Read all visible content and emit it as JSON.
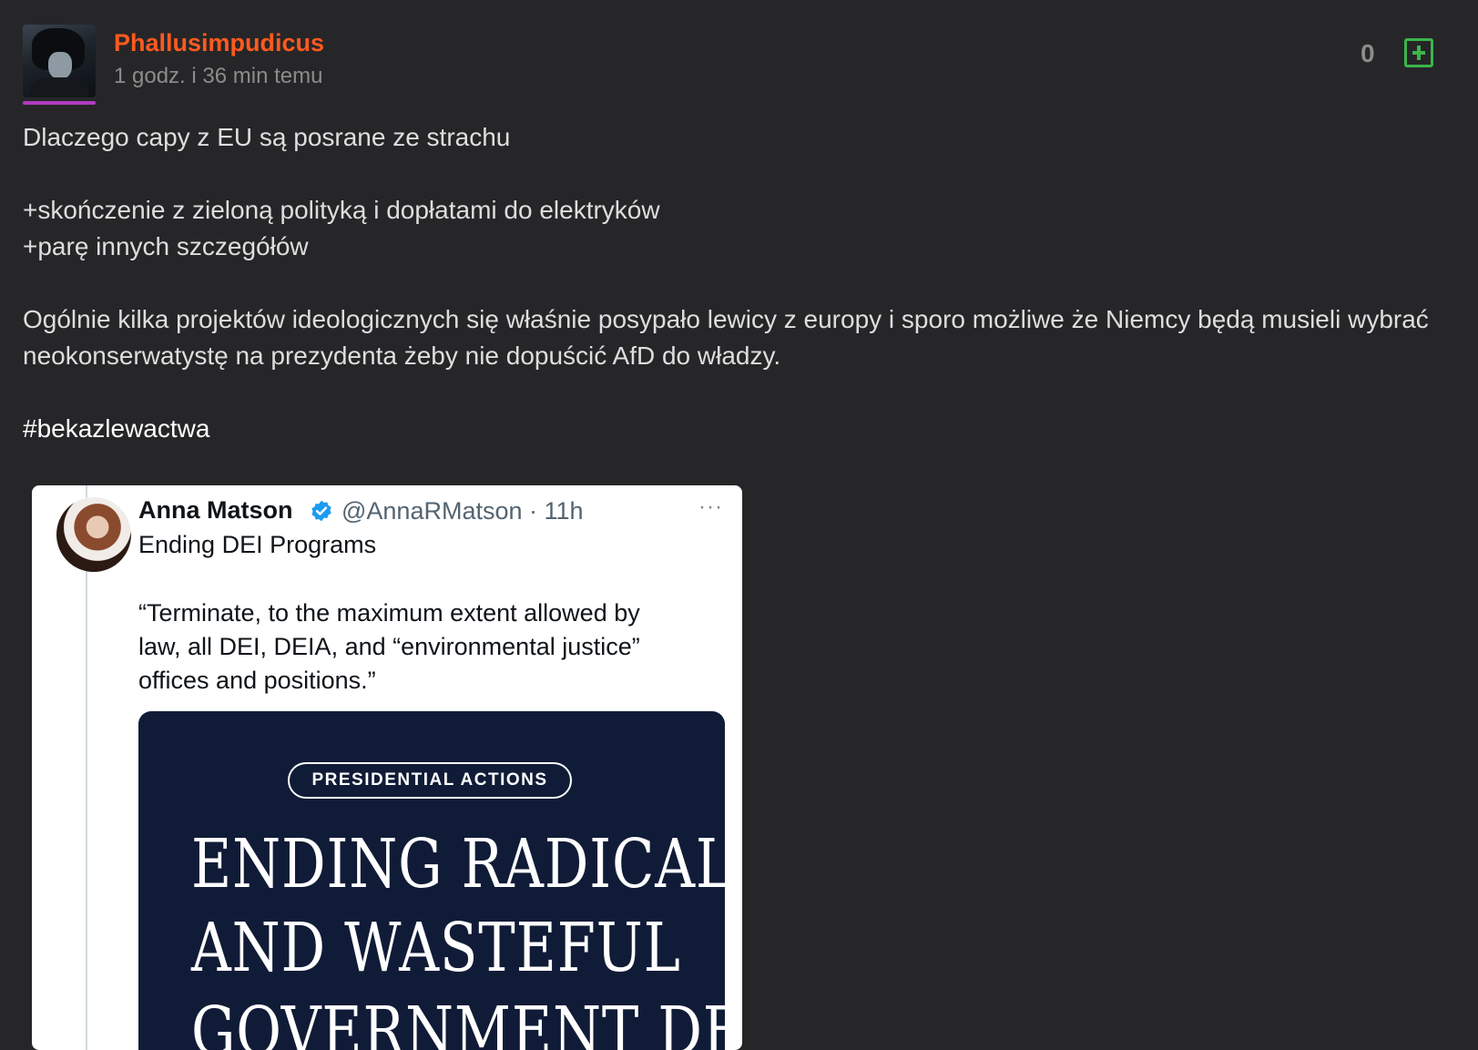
{
  "post": {
    "author": "Phallusimpudicus",
    "timestamp": "1 godz. i 36 min temu",
    "vote_count": "0",
    "colors": {
      "author": "#ff5a1f",
      "vote_button": "#3bb54a",
      "avatar_bar": "#b03cc0"
    },
    "body": {
      "line1": "Dlaczego capy z EU są posrane ze strachu",
      "line2": "+skończenie z zieloną polityką i dopłatami do elektryków",
      "line3": "+parę innych szczegółów",
      "line4": "Ogólnie kilka projektów ideologicznych się właśnie posypało lewicy z europy i sporo możliwe że Niemcy będą musieli wybrać neokonserwatystę na prezydenta żeby nie dopuścić AfD do władzy.",
      "hashtag": "#bekazlewactwa"
    }
  },
  "embed": {
    "name": "Anna Matson",
    "handle": "@AnnaRMatson · 11h",
    "more": "···",
    "heading": "Ending DEI Programs",
    "quote_line1": "“Terminate, to the maximum extent allowed by",
    "quote_line2": "law, all DEI, DEIA, and “environmental justice”",
    "quote_line3": "offices and positions.”",
    "card_pill": "PRESIDENTIAL ACTIONS",
    "card_title_line1": "ENDING RADICAL",
    "card_title_line2": "AND WASTEFUL",
    "card_title_line3": "GOVERNMENT DEI"
  }
}
